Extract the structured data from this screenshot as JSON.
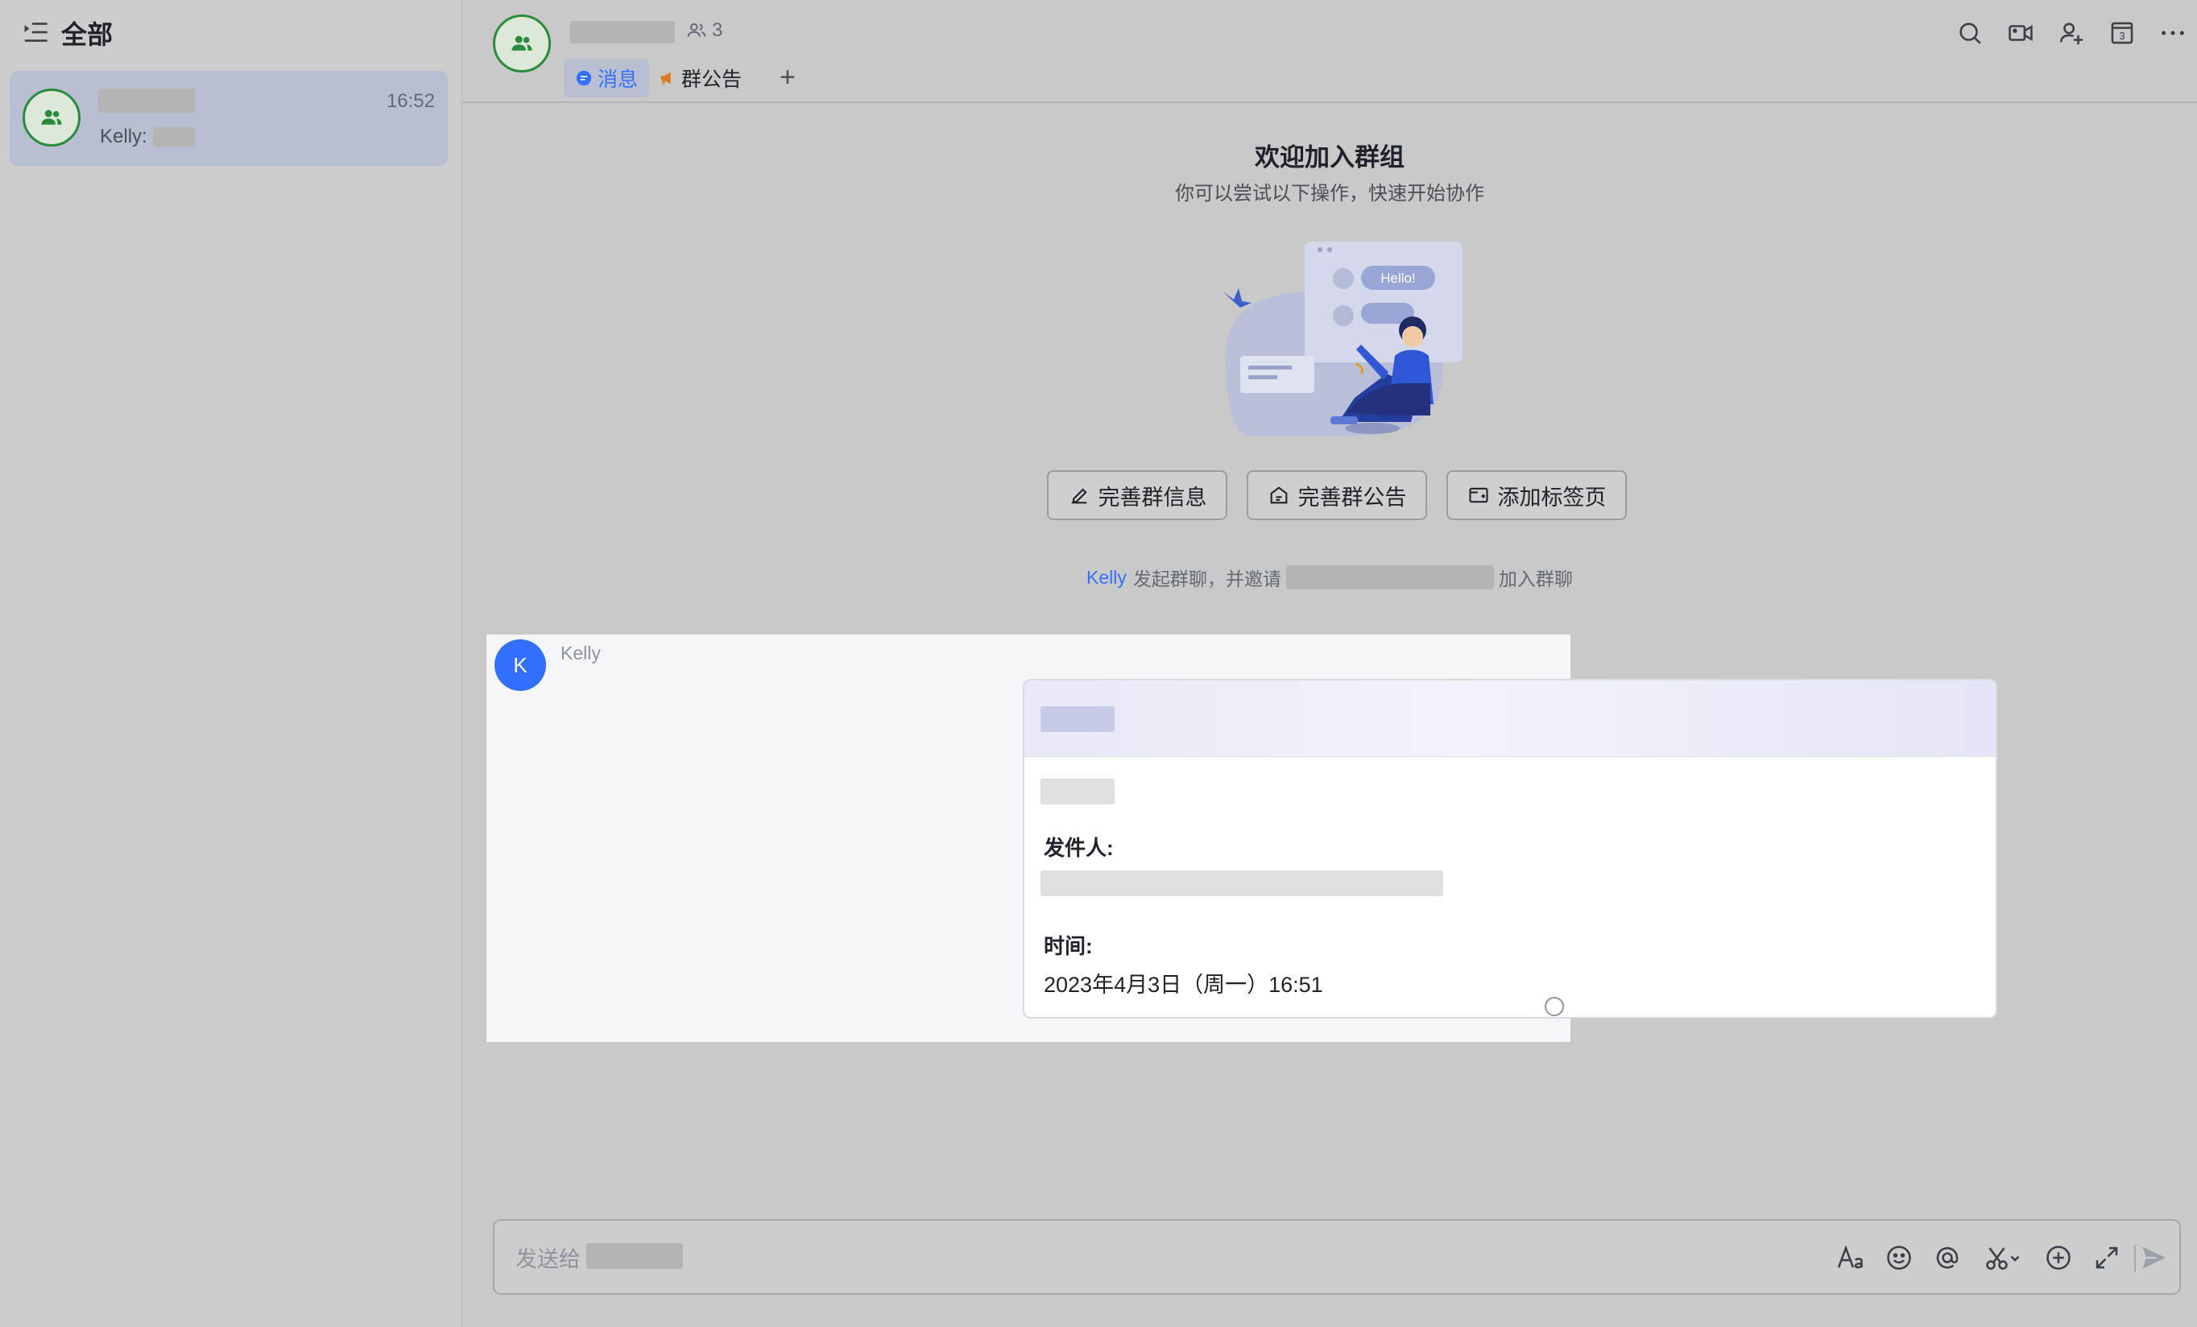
{
  "sidebar": {
    "title": "全部",
    "chats": [
      {
        "time": "16:52",
        "preview_sender": "Kelly:"
      }
    ]
  },
  "header": {
    "member_count": "3",
    "tabs": [
      {
        "label": "消息",
        "active": true
      },
      {
        "label": "群公告",
        "active": false
      }
    ],
    "add_tab": "+",
    "toolbar_icons": [
      "search-icon",
      "video-icon",
      "add-member-icon",
      "calendar-icon",
      "more-icon"
    ],
    "calendar_day": "3"
  },
  "welcome": {
    "title": "欢迎加入群组",
    "subtitle": "你可以尝试以下操作，快速开始协作",
    "illustration_bubble": "Hello!",
    "actions": [
      {
        "label": "完善群信息",
        "icon": "edit-icon"
      },
      {
        "label": "完善群公告",
        "icon": "announcement-icon"
      },
      {
        "label": "添加标签页",
        "icon": "tab-icon"
      }
    ]
  },
  "system_message": {
    "actor": "Kelly",
    "text_before": "发起群聊，并邀请",
    "text_after": "加入群聊"
  },
  "message": {
    "sender": "Kelly",
    "avatar_letter": "K",
    "card": {
      "sender_label": "发件人:",
      "time_label": "时间:",
      "time_value": "2023年4月3日（周一）16:51"
    }
  },
  "composer": {
    "placeholder": "发送给",
    "icons": [
      "font-format-icon",
      "emoji-icon",
      "mention-icon",
      "screenshot-icon",
      "add-icon",
      "expand-icon",
      "send-icon"
    ]
  },
  "colors": {
    "accent": "#3370ff",
    "group_avatar_border": "#2b8a3e",
    "selected_chat_bg": "#b8bfd1",
    "announcement_icon": "#e07a1f"
  }
}
